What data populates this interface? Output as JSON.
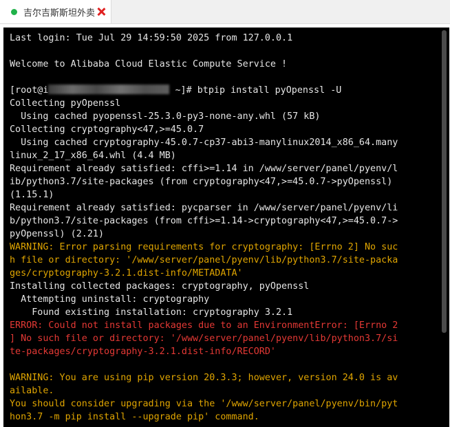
{
  "tab": {
    "title": "吉尔吉斯斯坦外卖",
    "status_color": "#20b24a",
    "close_color": "#e02020"
  },
  "colors": {
    "default": "#e6e6e6",
    "warning": "#e0a500",
    "error": "#e53935"
  },
  "terminal": {
    "lines": [
      {
        "text": "Last login: Tue Jul 29 14:59:50 2025 from 127.0.0.1",
        "style": "default"
      },
      {
        "text": "",
        "style": "default"
      },
      {
        "text": "Welcome to Alibaba Cloud Elastic Compute Service !",
        "style": "default"
      },
      {
        "text": "",
        "style": "default"
      },
      {
        "prompt_prefix": "[root@i",
        "prompt_suffix": " ~]# btpip install pyOpenssl -U",
        "style": "prompt"
      },
      {
        "text": "Collecting pyOpenssl",
        "style": "default"
      },
      {
        "text": "  Using cached pyopenssl-25.3.0-py3-none-any.whl (57 kB)",
        "style": "default"
      },
      {
        "text": "Collecting cryptography<47,>=45.0.7",
        "style": "default"
      },
      {
        "text": "  Using cached cryptography-45.0.7-cp37-abi3-manylinux2014_x86_64.many",
        "style": "default"
      },
      {
        "text": "linux_2_17_x86_64.whl (4.4 MB)",
        "style": "default"
      },
      {
        "text": "Requirement already satisfied: cffi>=1.14 in /www/server/panel/pyenv/l",
        "style": "default"
      },
      {
        "text": "ib/python3.7/site-packages (from cryptography<47,>=45.0.7->pyOpenssl)",
        "style": "default"
      },
      {
        "text": "(1.15.1)",
        "style": "default"
      },
      {
        "text": "Requirement already satisfied: pycparser in /www/server/panel/pyenv/li",
        "style": "default"
      },
      {
        "text": "b/python3.7/site-packages (from cffi>=1.14->cryptography<47,>=45.0.7->",
        "style": "default"
      },
      {
        "text": "pyOpenssl) (2.21)",
        "style": "default"
      },
      {
        "text": "WARNING: Error parsing requirements for cryptography: [Errno 2] No suc",
        "style": "warning"
      },
      {
        "text": "h file or directory: '/www/server/panel/pyenv/lib/python3.7/site-packa",
        "style": "warning"
      },
      {
        "text": "ges/cryptography-3.2.1.dist-info/METADATA'",
        "style": "warning"
      },
      {
        "text": "Installing collected packages: cryptography, pyOpenssl",
        "style": "default"
      },
      {
        "text": "  Attempting uninstall: cryptography",
        "style": "default"
      },
      {
        "text": "    Found existing installation: cryptography 3.2.1",
        "style": "default"
      },
      {
        "text": "ERROR: Could not install packages due to an EnvironmentError: [Errno 2",
        "style": "error"
      },
      {
        "text": "] No such file or directory: '/www/server/panel/pyenv/lib/python3.7/si",
        "style": "error"
      },
      {
        "text": "te-packages/cryptography-3.2.1.dist-info/RECORD'",
        "style": "error"
      },
      {
        "text": "",
        "style": "default"
      },
      {
        "text": "WARNING: You are using pip version 20.3.3; however, version 24.0 is av",
        "style": "warning"
      },
      {
        "text": "ailable.",
        "style": "warning"
      },
      {
        "text": "You should consider upgrading via the '/www/server/panel/pyenv/bin/pyt",
        "style": "warning"
      },
      {
        "text": "hon3.7 -m pip install --upgrade pip' command.",
        "style": "warning"
      }
    ]
  }
}
